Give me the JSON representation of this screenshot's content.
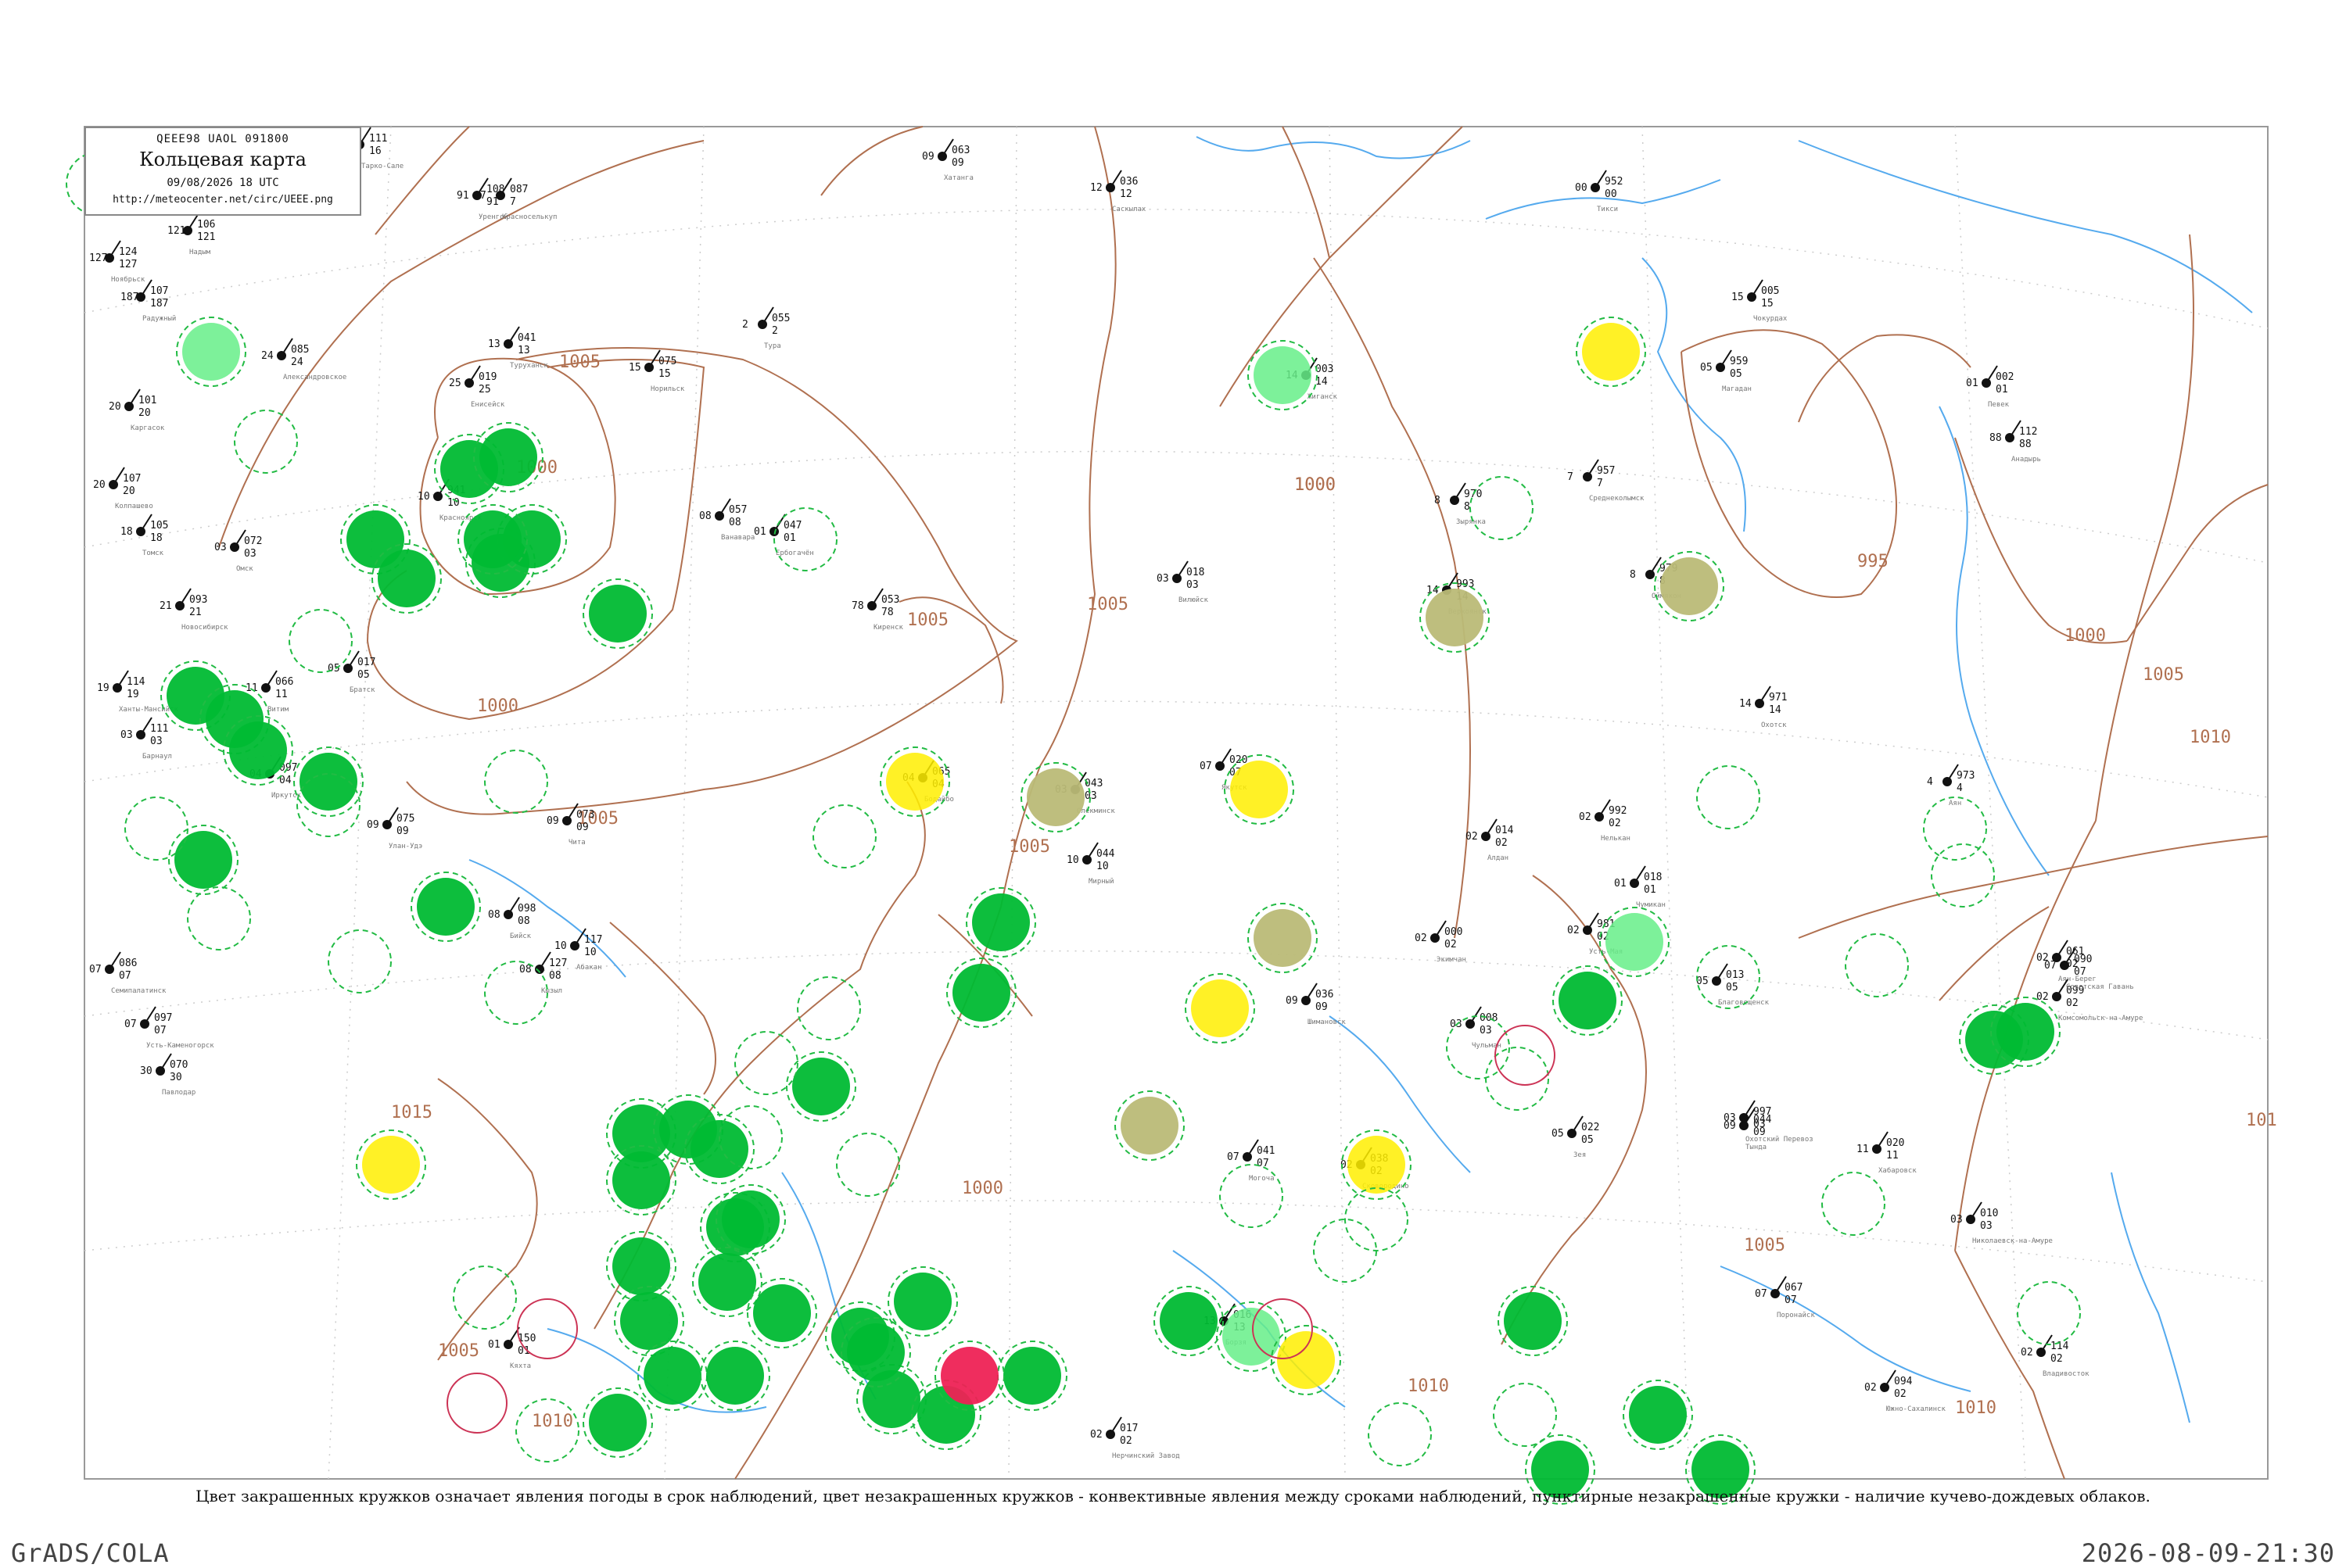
{
  "header": {
    "code": "QEEE98  UAOL  091800",
    "title": "Кольцевая карта",
    "datetime": "09/08/2026 18 UTC",
    "url": "http://meteocenter.net/circ/UEEE.png"
  },
  "caption": "Цвет закрашенных кружков означает явления погоды в срок наблюдений, цвет незакрашенных кружков - конвективные явления между сроками наблюдений, пунктирные незакрашенные кружки - наличие кучево-дождевых облаков.",
  "footer": {
    "left": "GrADS/COLA",
    "right": "2026-08-09-21:30"
  },
  "colors": {
    "isobar": "#b07050",
    "river": "#55aaee",
    "rain_fill": "#00bb33",
    "shower_fill": "#66ee88",
    "fog_fill": "#ffee00",
    "haze_fill": "#bbbb77",
    "thunder_fill": "#ee2255",
    "cb_dashed": "#22bb44"
  },
  "isobar_labels": [
    {
      "text": "1000"
    },
    {
      "text": "1000"
    },
    {
      "text": "1005"
    },
    {
      "text": "1005"
    },
    {
      "text": "1005"
    },
    {
      "text": "1000"
    },
    {
      "text": "1005"
    },
    {
      "text": "1005"
    },
    {
      "text": "1000"
    },
    {
      "text": "995"
    },
    {
      "text": "1000"
    },
    {
      "text": "1005"
    },
    {
      "text": "1010"
    },
    {
      "text": "1010"
    },
    {
      "text": "1015"
    },
    {
      "text": "1010"
    },
    {
      "text": "1000"
    },
    {
      "text": "1005"
    },
    {
      "text": "1010"
    },
    {
      "text": "1005"
    },
    {
      "text": "101"
    }
  ],
  "stations": [
    {
      "name": "Тарко-Сале",
      "p": "111",
      "t": "16"
    },
    {
      "name": "Уренгой",
      "p": "108",
      "t": "91"
    },
    {
      "name": "Красноселькуп",
      "p": "087",
      "t": "7"
    },
    {
      "name": "Надым",
      "p": "106",
      "t": "121"
    },
    {
      "name": "Ноябрьск",
      "p": "124",
      "t": "127"
    },
    {
      "name": "Радужный",
      "p": "107",
      "t": "187"
    },
    {
      "name": "Александровское",
      "p": "085",
      "t": "24"
    },
    {
      "name": "Каргасок",
      "p": "101",
      "t": "20"
    },
    {
      "name": "Колпашево",
      "p": "107",
      "t": "20"
    },
    {
      "name": "Томск",
      "p": "105",
      "t": "18"
    },
    {
      "name": "Новосибирск",
      "p": "093",
      "t": "21"
    },
    {
      "name": "Барнаул",
      "p": "111",
      "t": "03"
    },
    {
      "name": "Туруханск",
      "p": "041",
      "t": "13"
    },
    {
      "name": "Енисейск",
      "p": "019",
      "t": "25"
    },
    {
      "name": "Красноярск",
      "p": "941",
      "t": "10"
    },
    {
      "name": "Ванавара",
      "p": "057",
      "t": "08"
    },
    {
      "name": "Ербогачён",
      "p": "047",
      "t": "01"
    },
    {
      "name": "Киренск",
      "p": "053",
      "t": "78"
    },
    {
      "name": "Братск",
      "p": "017",
      "t": "05"
    },
    {
      "name": "Иркутск",
      "p": "097",
      "t": "04"
    },
    {
      "name": "Улан-Удэ",
      "p": "075",
      "t": "09"
    },
    {
      "name": "Чита",
      "p": "073",
      "t": "09"
    },
    {
      "name": "Бодайбо",
      "p": "065",
      "t": "04"
    },
    {
      "name": "Витим",
      "p": "066",
      "t": "11"
    },
    {
      "name": "Олёкминск",
      "p": "043",
      "t": "03"
    },
    {
      "name": "Якутск",
      "p": "020",
      "t": "07"
    },
    {
      "name": "Мирный",
      "p": "044",
      "t": "10"
    },
    {
      "name": "Вилюйск",
      "p": "018",
      "t": "03"
    },
    {
      "name": "Жиганск",
      "p": "003",
      "t": "14"
    },
    {
      "name": "Верхоянск",
      "p": "993",
      "t": "14"
    },
    {
      "name": "Оймякон",
      "p": "979",
      "t": "8"
    },
    {
      "name": "Магадан",
      "p": "959",
      "t": "05"
    },
    {
      "name": "Охотск",
      "p": "971",
      "t": "14"
    },
    {
      "name": "Аян",
      "p": "973",
      "t": "4"
    },
    {
      "name": "Николаевск-на-Амуре",
      "p": "010",
      "t": "03"
    },
    {
      "name": "Хабаровск",
      "p": "020",
      "t": "11"
    },
    {
      "name": "Владивосток",
      "p": "114",
      "t": "02"
    },
    {
      "name": "Благовещенск",
      "p": "013",
      "t": "05"
    },
    {
      "name": "Тында",
      "p": "044",
      "t": "09"
    },
    {
      "name": "Зея",
      "p": "022",
      "t": "05"
    },
    {
      "name": "Сковородино",
      "p": "038",
      "t": "02"
    },
    {
      "name": "Могоча",
      "p": "041",
      "t": "07"
    },
    {
      "name": "Нерчинский Завод",
      "p": "017",
      "t": "02"
    },
    {
      "name": "Борзя",
      "p": "016",
      "t": "13"
    },
    {
      "name": "Кяхта",
      "p": "150",
      "t": "01"
    },
    {
      "name": "Кызыл",
      "p": "127",
      "t": "08"
    },
    {
      "name": "Абакан",
      "p": "117",
      "t": "10"
    },
    {
      "name": "Бийск",
      "p": "098",
      "t": "08"
    },
    {
      "name": "Семипалатинск",
      "p": "086",
      "t": "07"
    },
    {
      "name": "Усть-Каменогорск",
      "p": "097",
      "t": "07"
    },
    {
      "name": "Павлодар",
      "p": "070",
      "t": "30"
    },
    {
      "name": "Омск",
      "p": "072",
      "t": "03"
    },
    {
      "name": "Ханты-Мансийск",
      "p": "114",
      "t": "19"
    },
    {
      "name": "Тура",
      "p": "055",
      "t": "2"
    },
    {
      "name": "Норильск",
      "p": "075",
      "t": "15"
    },
    {
      "name": "Хатанга",
      "p": "063",
      "t": "09"
    },
    {
      "name": "Саскылах",
      "p": "036",
      "t": "12"
    },
    {
      "name": "Тикси",
      "p": "952",
      "t": "00"
    },
    {
      "name": "Чокурдах",
      "p": "005",
      "t": "15"
    },
    {
      "name": "Среднеколымск",
      "p": "957",
      "t": "7"
    },
    {
      "name": "Зырянка",
      "p": "970",
      "t": "8"
    },
    {
      "name": "Певек",
      "p": "002",
      "t": "01"
    },
    {
      "name": "Анадырь",
      "p": "112",
      "t": "88"
    },
    {
      "name": "Южно-Сахалинск",
      "p": "094",
      "t": "02"
    },
    {
      "name": "Шимановск",
      "p": "036",
      "t": "09"
    },
    {
      "name": "Экимчан",
      "p": "000",
      "t": "02"
    },
    {
      "name": "Чульман",
      "p": "008",
      "t": "03"
    },
    {
      "name": "Алдан",
      "p": "014",
      "t": "02"
    },
    {
      "name": "Усть-Мая",
      "p": "981",
      "t": "02"
    },
    {
      "name": "Охотский Перевоз",
      "p": "997",
      "t": "03"
    },
    {
      "name": "Нелькан",
      "p": "992",
      "t": "02"
    },
    {
      "name": "Чумикан",
      "p": "018",
      "t": "01"
    },
    {
      "name": "Аян-Берег",
      "p": "061",
      "t": "02"
    },
    {
      "name": "Комсомольск-на-Амуре",
      "p": "099",
      "t": "02"
    },
    {
      "name": "Советская Гавань",
      "p": "090",
      "t": "07"
    },
    {
      "name": "Поронайск",
      "p": "067",
      "t": "07"
    }
  ]
}
